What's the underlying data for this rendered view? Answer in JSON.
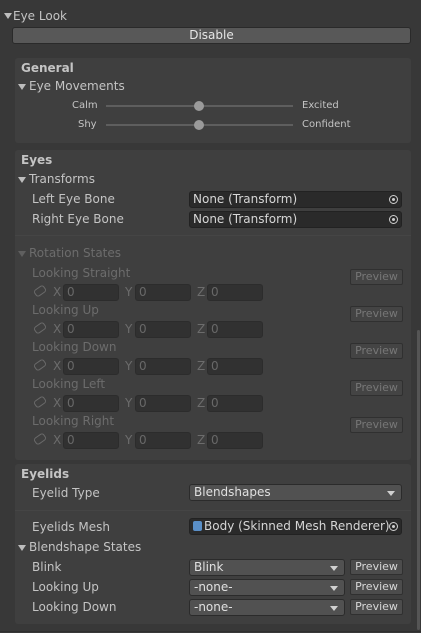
{
  "header": {
    "title": "Eye Look",
    "disable_label": "Disable"
  },
  "general": {
    "heading": "General",
    "eye_movements": {
      "label": "Eye Movements",
      "sliders": [
        {
          "left": "Calm",
          "right": "Excited",
          "value": 0.5
        },
        {
          "left": "Shy",
          "right": "Confident",
          "value": 0.5
        }
      ]
    }
  },
  "eyes": {
    "heading": "Eyes",
    "transforms": {
      "label": "Transforms",
      "left_eye_label": "Left Eye Bone",
      "left_eye_value": "None (Transform)",
      "right_eye_label": "Right Eye Bone",
      "right_eye_value": "None (Transform)"
    },
    "rotation_states": {
      "label": "Rotation States",
      "preview_label": "Preview",
      "axis_x": "X",
      "axis_y": "Y",
      "axis_z": "Z",
      "items": [
        {
          "label": "Looking Straight",
          "x": "0",
          "y": "0",
          "z": "0"
        },
        {
          "label": "Looking Up",
          "x": "0",
          "y": "0",
          "z": "0"
        },
        {
          "label": "Looking Down",
          "x": "0",
          "y": "0",
          "z": "0"
        },
        {
          "label": "Looking Left",
          "x": "0",
          "y": "0",
          "z": "0"
        },
        {
          "label": "Looking Right",
          "x": "0",
          "y": "0",
          "z": "0"
        }
      ]
    }
  },
  "eyelids": {
    "heading": "Eyelids",
    "type_label": "Eyelid Type",
    "type_value": "Blendshapes",
    "mesh_label": "Eyelids Mesh",
    "mesh_value": "Body (Skinned Mesh Renderer)",
    "blendshape_states": {
      "label": "Blendshape States",
      "preview_label": "Preview",
      "items": [
        {
          "label": "Blink",
          "value": "Blink"
        },
        {
          "label": "Looking Up",
          "value": "-none-"
        },
        {
          "label": "Looking Down",
          "value": "-none-"
        }
      ]
    }
  }
}
